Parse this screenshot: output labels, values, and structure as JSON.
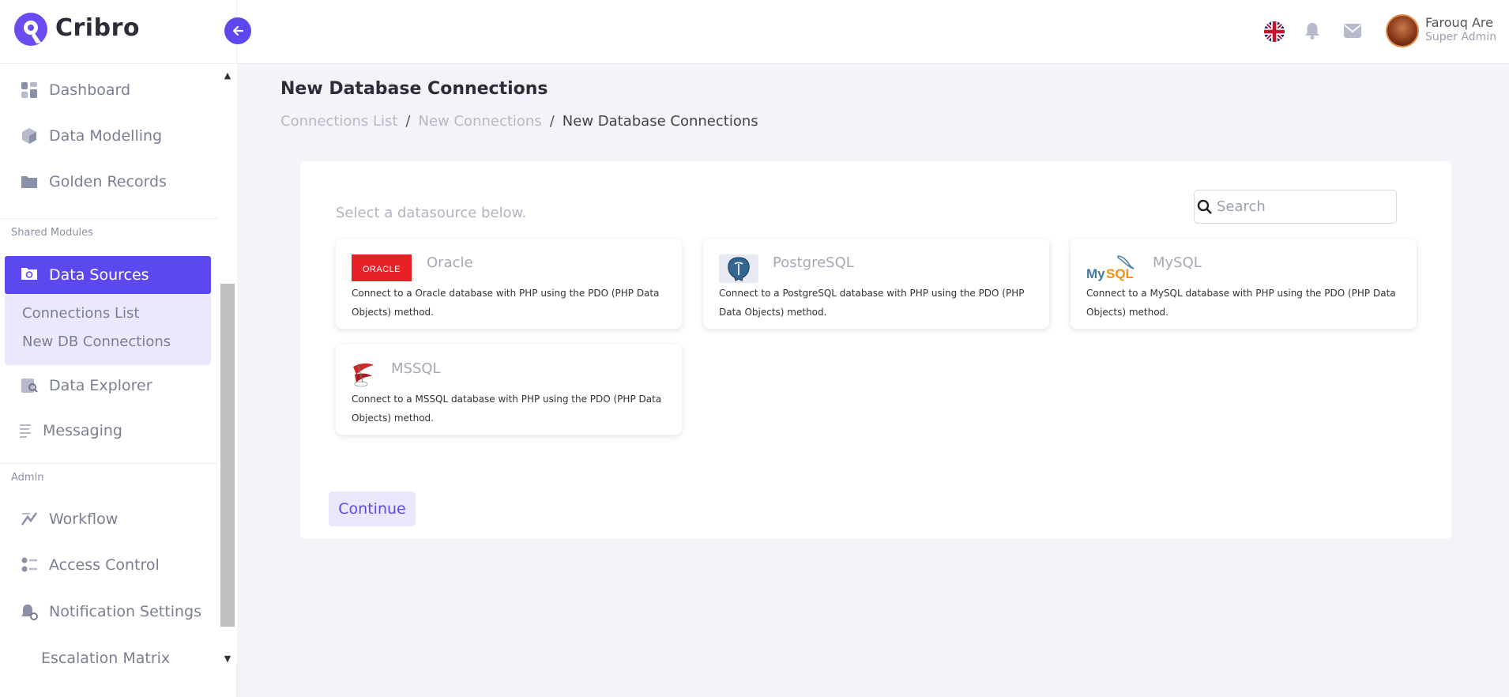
{
  "app": {
    "name": "Cribro"
  },
  "colors": {
    "accent": "#5b48ef",
    "accent_light": "#ebe8fd"
  },
  "sidebar": {
    "items_top": [
      {
        "label": "Dashboard",
        "icon": "dashboard-icon"
      },
      {
        "label": "Data Modelling",
        "icon": "cube-icon"
      },
      {
        "label": "Golden Records",
        "icon": "folder-icon"
      }
    ],
    "section_shared": "Shared Modules",
    "active": {
      "label": "Data Sources",
      "icon": "data-sources-icon"
    },
    "submenu": [
      "Connections List",
      "New DB Connections"
    ],
    "items_mid": [
      {
        "label": "Data Explorer",
        "icon": "data-explorer-icon"
      },
      {
        "label": "Messaging",
        "icon": "messaging-icon"
      }
    ],
    "section_admin": "Admin",
    "items_admin": [
      {
        "label": "Workflow",
        "icon": "workflow-icon"
      },
      {
        "label": "Access Control",
        "icon": "access-control-icon"
      },
      {
        "label": "Notification Settings",
        "icon": "notification-settings-icon"
      },
      {
        "label": "Escalation Matrix"
      }
    ]
  },
  "header": {
    "language_icon": "uk-flag-icon",
    "user": {
      "name": "Farouq Are",
      "role": "Super Admin"
    }
  },
  "page": {
    "title": "New Database Connections",
    "breadcrumb": [
      "Connections List",
      "New Connections",
      "New Database Connections"
    ],
    "select_text": "Select a datasource below.",
    "search_placeholder": "Search",
    "datasources": [
      {
        "name": "Oracle",
        "description": "Connect to a Oracle database with PHP using the PDO (PHP Data Objects) method.",
        "logo": "oracle-logo"
      },
      {
        "name": "PostgreSQL",
        "description": "Connect to a PostgreSQL database with PHP using the PDO (PHP Data Objects) method.",
        "logo": "postgresql-logo"
      },
      {
        "name": "MySQL",
        "description": "Connect to a MySQL database with PHP using the PDO (PHP Data Objects) method.",
        "logo": "mysql-logo"
      },
      {
        "name": "MSSQL",
        "description": "Connect to a MSSQL database with PHP using the PDO (PHP Data Objects) method.",
        "logo": "mssql-logo"
      }
    ],
    "continue_label": "Continue"
  }
}
